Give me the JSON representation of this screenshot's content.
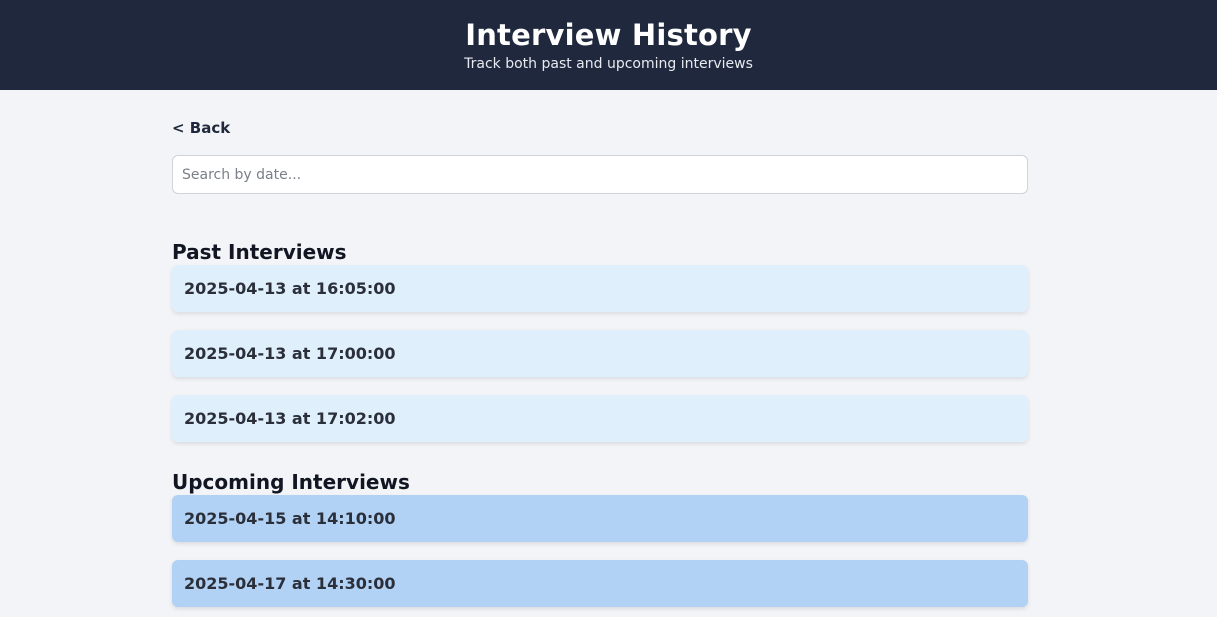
{
  "header": {
    "title": "Interview History",
    "subtitle": "Track both past and upcoming interviews"
  },
  "nav": {
    "back_label": "< Back"
  },
  "search": {
    "placeholder": "Search by date...",
    "value": ""
  },
  "past": {
    "title": "Past Interviews",
    "items": [
      {
        "label": "2025-04-13 at 16:05:00"
      },
      {
        "label": "2025-04-13 at 17:00:00"
      },
      {
        "label": "2025-04-13 at 17:02:00"
      }
    ]
  },
  "upcoming": {
    "title": "Upcoming Interviews",
    "items": [
      {
        "label": "2025-04-15 at 14:10:00"
      },
      {
        "label": "2025-04-17 at 14:30:00"
      }
    ]
  },
  "colors": {
    "header_bg": "#1f283d",
    "page_bg": "#f3f4f7",
    "past_item_bg": "#e0effc",
    "upcoming_item_bg": "#b1d2f5"
  }
}
